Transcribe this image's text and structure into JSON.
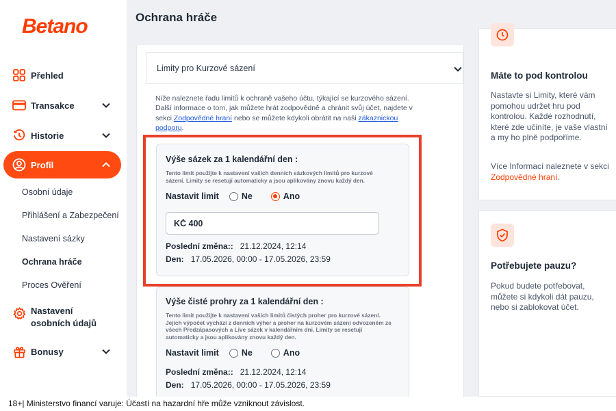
{
  "brand": {
    "name": "Betano",
    "accent": "#ff3c00"
  },
  "sidebar": {
    "items": [
      {
        "label": "Přehled",
        "icon": "grid-icon"
      },
      {
        "label": "Transakce",
        "icon": "card-icon"
      },
      {
        "label": "Historie",
        "icon": "history-icon"
      },
      {
        "label": "Profil",
        "icon": "user-icon"
      },
      {
        "label": "Nastavení osobních údajů",
        "line1": "Nastavení",
        "line2": "osobních údajů",
        "icon": "gear-icon"
      },
      {
        "label": "Bonusy",
        "icon": "gift-icon"
      }
    ],
    "profile_sub": [
      "Osobní údaje",
      "Přihlášení a Zabezpečení",
      "Nastavení sázky",
      "Ochrana hráče",
      "Proces Ověření"
    ]
  },
  "header": {
    "title": "Ochrana hráče"
  },
  "main": {
    "accordion_label": "Limity pro Kurzové sázení",
    "intro": {
      "text1": "Níže naleznete řadu limitů k ochraně vašeho účtu, týkající se kurzového sázení. Další informace o tom, jak můžete hrát zodpovědně a chránit svůj účet, najdete v sekci ",
      "link1": "Zodpovědné hraní",
      "text2": " nebo se můžete kdykoli obrátit na naši ",
      "link2": "zákaznickou podporu",
      "text3": "."
    },
    "limits": [
      {
        "title": "Výše sázek za 1 kalendářní den :",
        "desc": "Tento limit použijte k nastavení vašich denních sázkových limitů pro kurzové sázení. Limity se resetují automaticky a jsou aplikovány znovu každý den.",
        "set_label": "Nastavit limit",
        "option_no": "Ne",
        "option_yes": "Ano",
        "selected": "Ano",
        "value": "KČ 400",
        "last_change_label": "Poslední změna::",
        "last_change_value": "21.12.2024, 12:14",
        "day_label": "Den:",
        "day_value": "17.05.2026, 00:00 - 17.05.2026, 23:59"
      },
      {
        "title": "Výše čisté prohry za 1 kalendářní den :",
        "desc": "Tento limit použijte k nastavení vašich limitů čistých proher pro kurzové sázení. Jejich výpočet vychází z denních výher a proher na kurzovém sázení odvozeném ze všech Předzápasových a Live sázek v kalendářním dni. Limity se resetují automaticky a jsou aplikovány znovu každý den.",
        "set_label": "Nastavit limit",
        "option_no": "Ne",
        "option_yes": "Ano",
        "selected": "none",
        "last_change_label": "Poslední změna::",
        "last_change_value": "21.12.2024, 12:14",
        "day_label": "Den:",
        "day_value": "17.05.2026, 00:00 - 17.05.2026, 23:59"
      }
    ]
  },
  "right": {
    "card1": {
      "title": "Máte to pod kontrolou",
      "text": "Nastavte si Limity, které vám pomohou udržet hru pod kontrolou. Každé rozhodnutí, které zde učiníte, je vaše vlastní a my ho plně podpoříme.",
      "more_text": "Více Informací naleznete v sekci ",
      "more_link": "Zodpovědné hraní",
      "more_end": "."
    },
    "card2": {
      "title": "Potřebujete pauzu?",
      "text": "Pokud budete potřebovat, můžete si kdykoli dát pauzu, nebo si zablokovat účet."
    }
  },
  "footer": {
    "text": "18+| Ministerstvo financí varuje: Účastí na hazardní hře může vzniknout závislost."
  }
}
